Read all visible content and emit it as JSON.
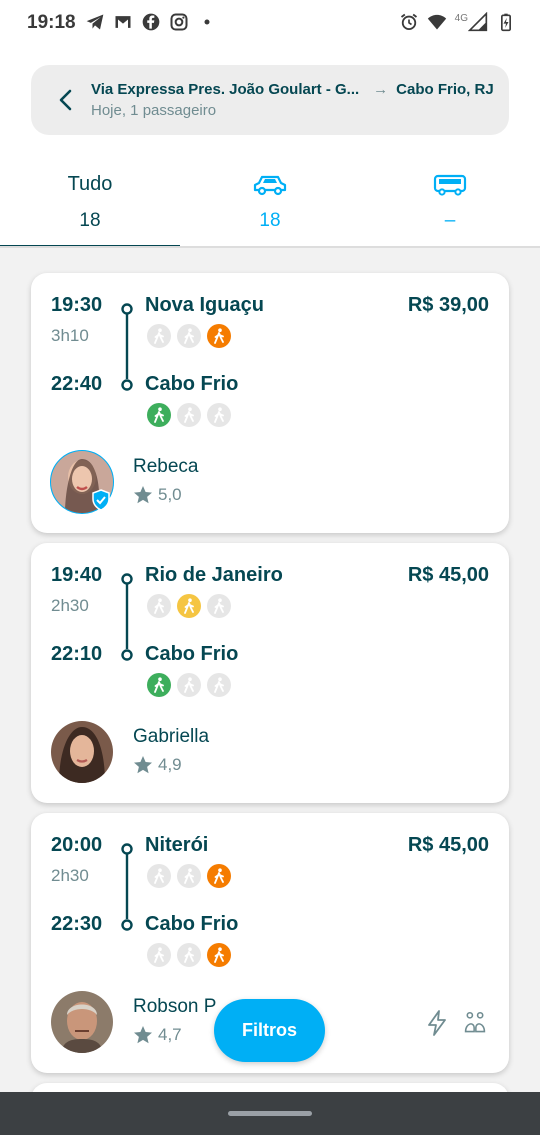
{
  "status_bar": {
    "time": "19:18",
    "network": "4G"
  },
  "search": {
    "from": "Via Expressa Pres. João Goulart - G...",
    "to": "Cabo Frio, RJ",
    "details": "Hoje, 1 passageiro"
  },
  "tabs": [
    {
      "label": "Tudo",
      "count": "18",
      "active": true
    },
    {
      "icon": "car-icon",
      "count": "18"
    },
    {
      "icon": "bus-icon",
      "count": "–"
    }
  ],
  "rides": [
    {
      "dep_time": "19:30",
      "duration": "3h10",
      "arr_time": "22:40",
      "from": "Nova Iguaçu",
      "to": "Cabo Frio",
      "price": "R$ 39,00",
      "from_walk": [
        "none",
        "none",
        "orange"
      ],
      "to_walk": [
        "green",
        "none",
        "none"
      ],
      "driver": "Rebeca",
      "rating": "5,0",
      "verified": true
    },
    {
      "dep_time": "19:40",
      "duration": "2h30",
      "arr_time": "22:10",
      "from": "Rio de Janeiro",
      "to": "Cabo Frio",
      "price": "R$ 45,00",
      "from_walk": [
        "none",
        "yellow",
        "none"
      ],
      "to_walk": [
        "green",
        "none",
        "none"
      ],
      "driver": "Gabriella",
      "rating": "4,9",
      "verified": false
    },
    {
      "dep_time": "20:00",
      "duration": "2h30",
      "arr_time": "22:30",
      "from": "Niterói",
      "to": "Cabo Frio",
      "price": "R$ 45,00",
      "from_walk": [
        "none",
        "none",
        "orange"
      ],
      "to_walk": [
        "none",
        "none",
        "orange"
      ],
      "driver": "Robson P",
      "rating": "4,7",
      "verified": false,
      "icons": [
        "instant-booking-icon",
        "max-two-in-back-icon"
      ]
    }
  ],
  "filter_button": "Filtros",
  "colors": {
    "primary": "#054752",
    "accent": "#00aff5",
    "orange": "#f57c00",
    "green": "#3dae5c",
    "yellow": "#f5c542"
  }
}
